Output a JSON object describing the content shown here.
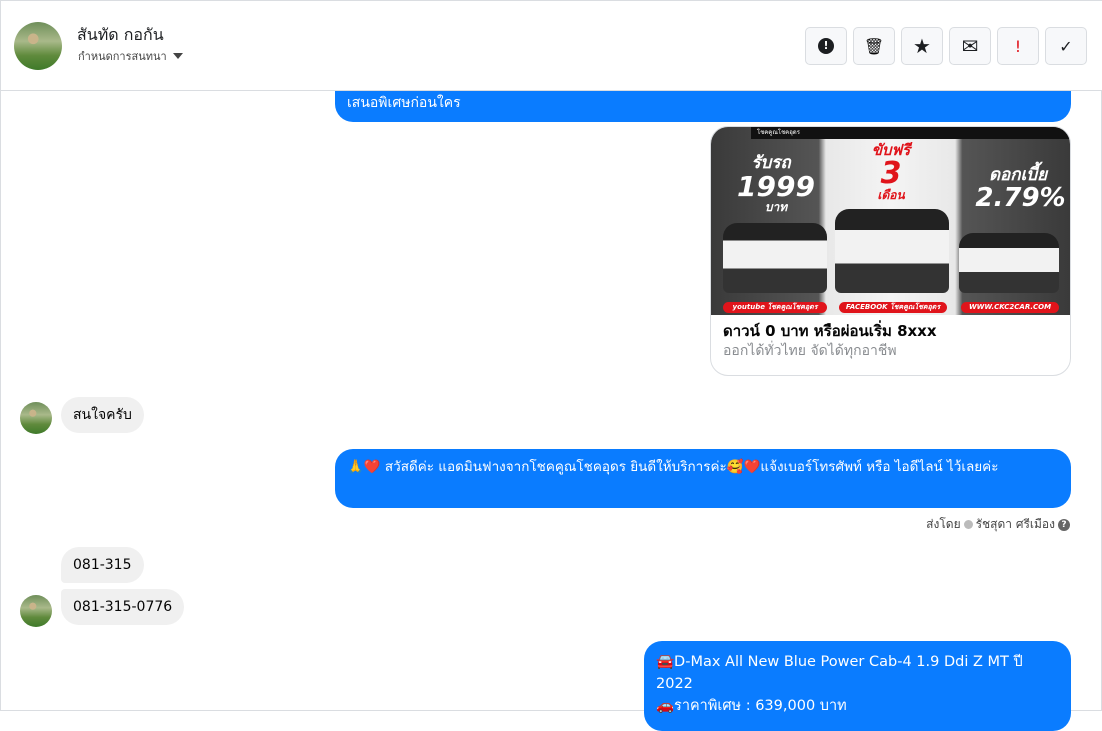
{
  "header": {
    "contact_name": "สันทัด กอกัน",
    "assign_label": "กำหนดการสนทนา",
    "buttons": [
      {
        "name": "spam",
        "glyph": "❗"
      },
      {
        "name": "delete",
        "glyph": "🗑"
      },
      {
        "name": "star",
        "glyph": "★"
      },
      {
        "name": "mark-unread",
        "glyph": "✉"
      },
      {
        "name": "important",
        "glyph": "!"
      },
      {
        "name": "done",
        "glyph": "✓"
      }
    ]
  },
  "messages": [
    {
      "from": "page",
      "text": "เสนอพิเศษก่อนใคร"
    },
    {
      "from": "page",
      "card": {
        "banner": {
          "left_top": "รับรถ",
          "left_num": "1999",
          "left_unit": "บาท",
          "mid_top": "ขับฟรี",
          "mid_num": "3",
          "mid_unit": "เดือน",
          "right_top": "ดอกเบี้ย",
          "right_num": "2.79%",
          "pill_1": "youtube โชคคูณโชคอุดร",
          "pill_2": "FACEBOOK โชคคูณโชคอุดร",
          "pill_3": "WWW.CKC2CAR.COM"
        },
        "title": "ดาวน์ 0 บาท หรือผ่อนเริ่ม 8xxx",
        "subtitle": "ออกได้ทั่วไทย จัดได้ทุกอาชีพ"
      }
    },
    {
      "from": "user",
      "text": "สนใจครับ"
    },
    {
      "from": "page",
      "text": "🙏❤️ สวัสดีค่ะ แอดมินฟางจากโชคคูณโชคอุดร ยินดีให้บริการค่ะ🥰❤️แจ้งเบอร์โทรศัพท์ หรือ ไอดีไลน์  ไว้เลยค่ะ"
    },
    {
      "from": "user",
      "text": "081-315"
    },
    {
      "from": "user",
      "text": "081-315-0776"
    },
    {
      "from": "page",
      "text_lines": [
        "🚘D-Max All New Blue Power Cab-4 1.9 Ddi Z MT ปี 2022",
        "🚗ราคาพิเศษ : 639,000 บาท"
      ]
    }
  ],
  "sent_by": {
    "label": "ส่งโดย",
    "agent": "รัชสุดา ศรีเมือง"
  },
  "colors": {
    "accent": "#0a7cff",
    "incoming": "#f0f0f0"
  }
}
